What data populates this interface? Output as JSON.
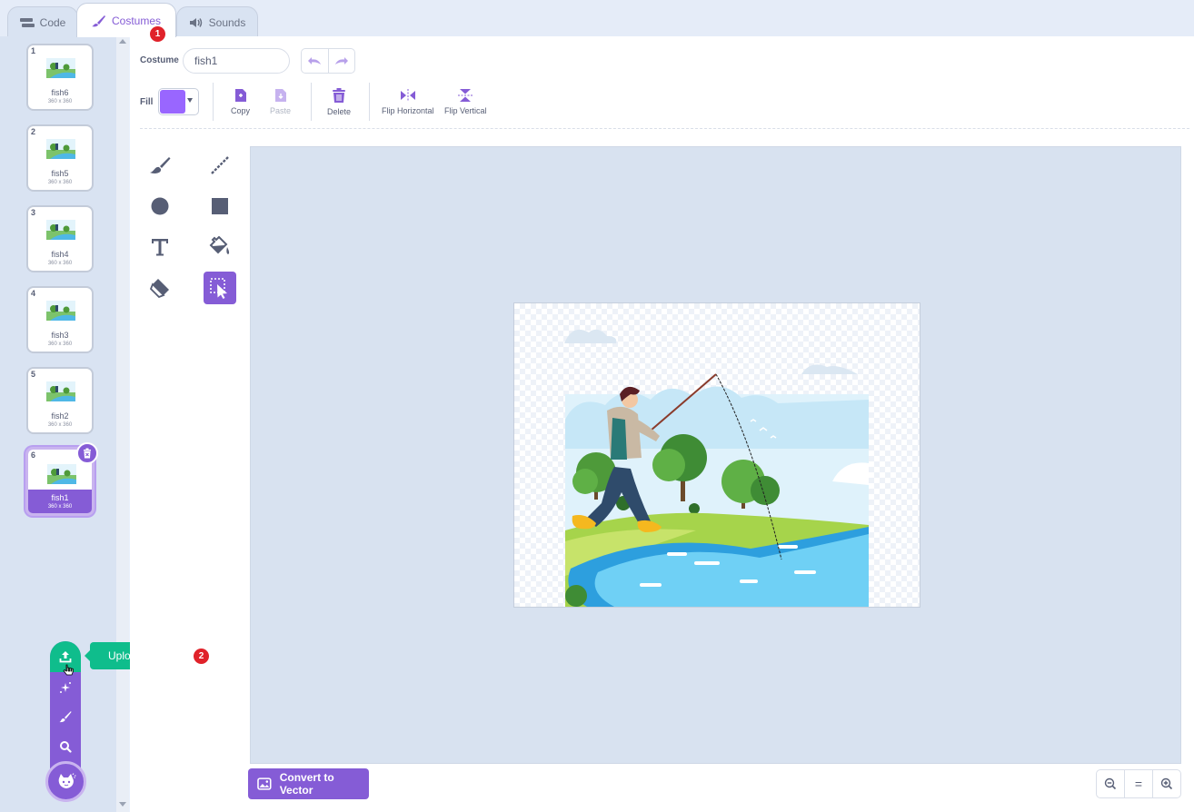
{
  "tabs": {
    "code": "Code",
    "costumes": "Costumes",
    "sounds": "Sounds"
  },
  "badges": {
    "first": "1",
    "second": "2"
  },
  "costumes": [
    {
      "num": "1",
      "name": "fish6",
      "size": "360 x 360"
    },
    {
      "num": "2",
      "name": "fish5",
      "size": "360 x 360"
    },
    {
      "num": "3",
      "name": "fish4",
      "size": "360 x 360"
    },
    {
      "num": "4",
      "name": "fish3",
      "size": "360 x 360"
    },
    {
      "num": "5",
      "name": "fish2",
      "size": "360 x 360"
    },
    {
      "num": "6",
      "name": "fish1",
      "size": "360 x 360",
      "selected": true
    }
  ],
  "add_menu": {
    "tooltip": "Upload Costume",
    "items": [
      "upload-icon",
      "surprise-icon",
      "paint-icon",
      "search-icon"
    ],
    "main_icon": "cat-icon"
  },
  "editor": {
    "costume_label": "Costume",
    "costume_name": "fish1",
    "fill_label": "Fill",
    "fill_color": "#9966ff",
    "buttons": {
      "copy": "Copy",
      "paste": "Paste",
      "delete": "Delete",
      "flip_horizontal": "Flip Horizontal",
      "flip_vertical": "Flip Vertical"
    },
    "tools": [
      "brush-icon",
      "line-icon",
      "circle-icon",
      "rectangle-icon",
      "text-icon",
      "fill-icon",
      "eraser-icon",
      "select-icon"
    ],
    "active_tool": "select-icon",
    "convert_button": "Convert to Vector",
    "zoom": {
      "out": "−",
      "reset": "=",
      "in": "+"
    }
  },
  "colors": {
    "accent": "#855cd6",
    "upload_green": "#0fbd8c",
    "badge_red": "#e0222a"
  }
}
